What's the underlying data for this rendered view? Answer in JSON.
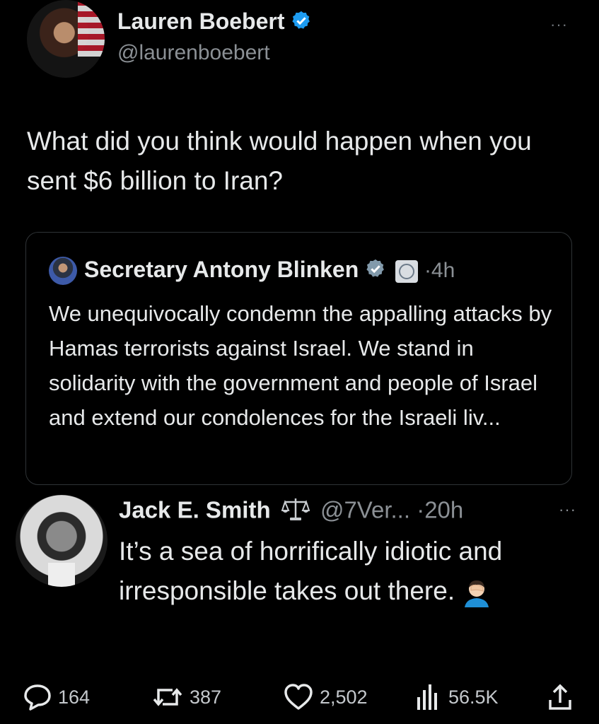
{
  "main_tweet": {
    "author_name": "Lauren Boebert",
    "author_handle": "@laurenboebert",
    "text": "What did you think would happen when you sent $6 billion to Iran?",
    "more_label": "···"
  },
  "quoted_tweet": {
    "author_name": "Secretary Antony Blinken",
    "time": "·4h",
    "text": "We unequivocally condemn the appalling attacks by Hamas terrorists against Israel. We stand in solidarity with the government and people of Israel and extend our condolences for the Israeli liv..."
  },
  "reply": {
    "author_name": "Jack E. Smith",
    "author_handle": "@7Ver...",
    "time": "·20h",
    "more_label": "···",
    "text": "It’s a sea of horrifically idiotic and irresponsible takes out there."
  },
  "actions": {
    "replies": "164",
    "reposts": "387",
    "likes": "2,502",
    "views": "56.5K"
  },
  "colors": {
    "background": "#000000",
    "verified_blue": "#1d9bf0",
    "text_primary": "#e7e9ea",
    "text_secondary": "#8b9095"
  }
}
